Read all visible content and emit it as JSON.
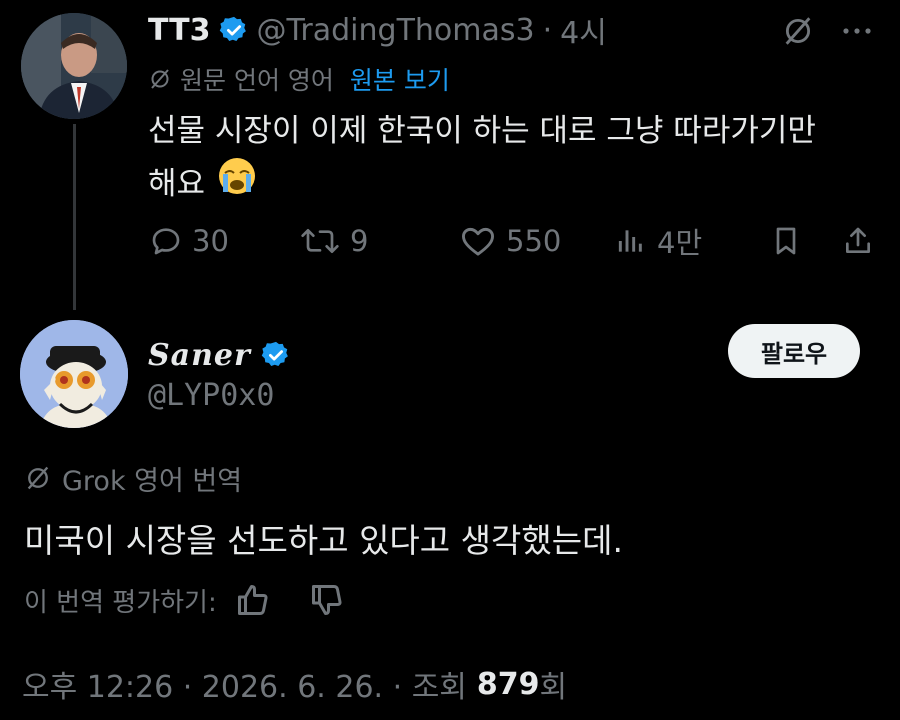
{
  "parent_tweet": {
    "display_name": "TT3",
    "handle": "@TradingThomas3",
    "separator": "·",
    "time": "4시",
    "translation_note": "원문 언어 영어",
    "show_original": "원본 보기",
    "text_line1": "선물 시장이 이제 한국이 하는 대로 그냥 따라가기만",
    "text_line2": "해요",
    "emoji": "😭",
    "replies": "30",
    "retweets": "9",
    "likes": "550",
    "views": "4만"
  },
  "reply_tweet": {
    "display_name": "Saner",
    "handle": "@LYP0x0",
    "follow_label": "팔로우",
    "translation_source": "Grok 영어 번역",
    "text": "미국이 시장을 선도하고 있다고 생각했는데.",
    "rate_label": "이 번역 평가하기:",
    "timestamp": "오후 12:26 · 2026. 6. 26. · 조회",
    "view_count": "879",
    "view_suffix": "회"
  },
  "colors": {
    "background": "#000000",
    "text_primary": "#e7e9ea",
    "text_secondary": "#71767b",
    "accent": "#1d9bf0",
    "thread_line": "#333639"
  },
  "icons": [
    "verified-badge-icon",
    "grok-slash-icon",
    "more-icon",
    "reply-icon",
    "retweet-icon",
    "like-icon",
    "views-icon",
    "bookmark-icon",
    "share-icon",
    "thumbs-up-icon",
    "thumbs-down-icon"
  ]
}
